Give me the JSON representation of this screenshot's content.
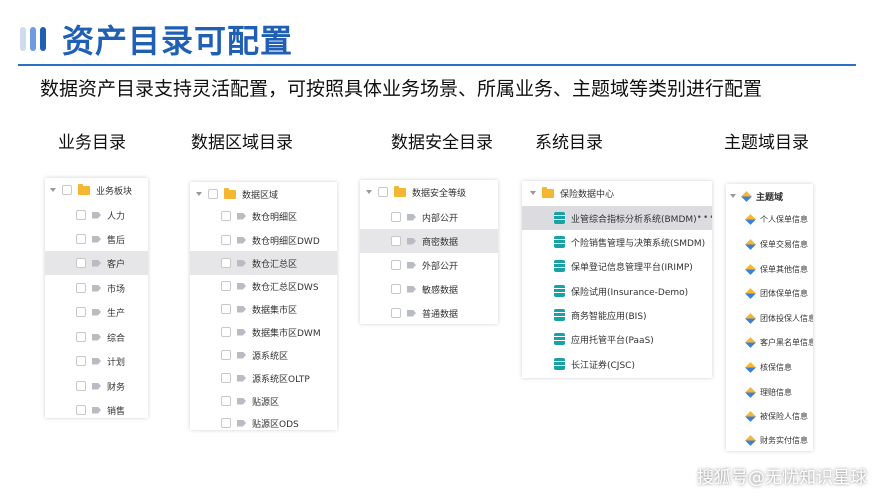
{
  "header": {
    "title": "资产目录可配置",
    "accent_colors": [
      "#cfdcf0",
      "#6f9be0",
      "#1f5fb4"
    ],
    "subtitle": "数据资产目录支持灵活配置，可按照具体业务场景、所属业务、主题域等类别进行配置"
  },
  "columns": {
    "business": {
      "heading": "业务目录",
      "root": "业务板块",
      "items": [
        "人力",
        "售后",
        "客户",
        "市场",
        "生产",
        "综合",
        "计划",
        "财务",
        "销售"
      ]
    },
    "region": {
      "heading": "数据区域目录",
      "root": "数据区域",
      "items": [
        "数仓明细区",
        "数仓明细区DWD",
        "数仓汇总区",
        "数仓汇总区DWS",
        "数据集市区",
        "数据集市区DWM",
        "源系统区",
        "源系统区OLTP",
        "贴源区",
        "贴源区ODS"
      ]
    },
    "security": {
      "heading": "数据安全目录",
      "root": "数据安全等级",
      "items": [
        "内部公开",
        "商密数据",
        "外部公开",
        "敏感数据",
        "普通数据"
      ]
    },
    "system": {
      "heading": "系统目录",
      "root": "保险数据中心",
      "items": [
        "业管综合指标分析系统(BMDM)",
        "个险销售管理与决策系统(SMDM)",
        "保单登记信息管理平台(IRIMP)",
        "保险试用(Insurance-Demo)",
        "商务智能应用(BIS)",
        "应用托管平台(PaaS)",
        "长江证券(CJSC)"
      ],
      "more": "•••"
    },
    "subject": {
      "heading": "主题域目录",
      "root": "主题域",
      "items": [
        "个人保单信息",
        "保单交易信息",
        "保单其他信息",
        "团体保单信息",
        "团体投保人信息",
        "客户黑名单信息",
        "核保信息",
        "理赔信息",
        "被保险人信息",
        "财务实付信息"
      ]
    }
  },
  "watermark": "搜狐号@无忧知识星球"
}
